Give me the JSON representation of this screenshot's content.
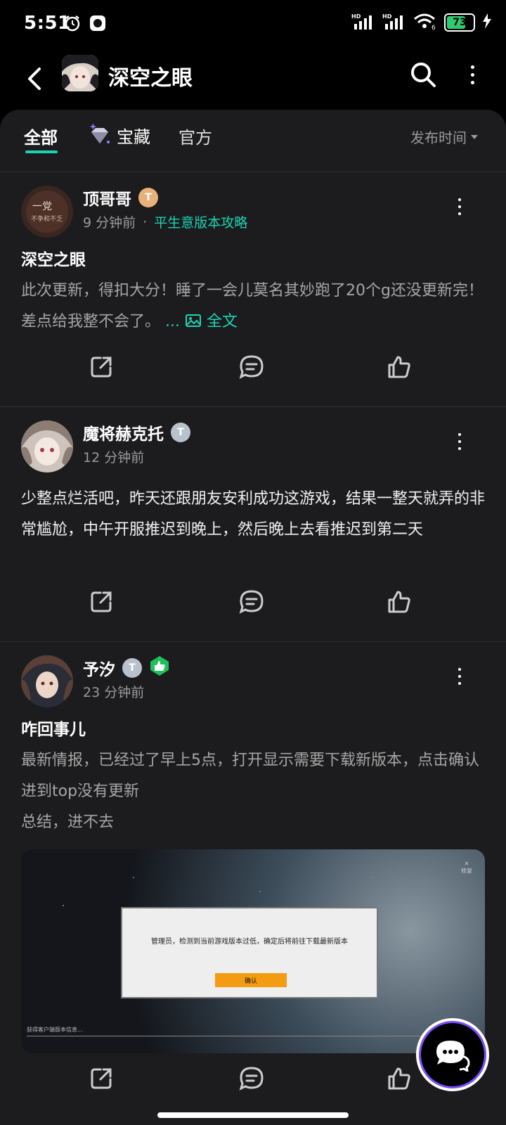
{
  "status_bar": {
    "time": "5:51",
    "battery": "73",
    "net_label_1": "HD",
    "net_label_2": "HD",
    "wifi_sub": "6"
  },
  "header": {
    "title": "深空之眼"
  },
  "tabs": {
    "all": "全部",
    "treasure": "宝藏",
    "official": "官方",
    "sort": "发布时间"
  },
  "posts": [
    {
      "author": "顶哥哥",
      "level": "T",
      "time": "9 分钟前",
      "topic": "平生意版本攻略",
      "title": "深空之眼",
      "body": "此次更新，得扣大分！睡了一会儿莫名其妙跑了20个g还没更新完！差点给我整不会了。",
      "ellipsis": "...",
      "full_text": "全文"
    },
    {
      "author": "魔将赫克托",
      "level": "T",
      "time": "12 分钟前",
      "body": "少整点烂活吧，昨天还跟朋友安利成功这游戏，结果一整天就弄的非常尴尬，中午开服推迟到晚上，然后晚上去看推迟到第二天"
    },
    {
      "author": "予汐",
      "level": "T",
      "time": "23 分钟前",
      "title": "咋回事儿",
      "body_line1": "最新情报，已经过了早上5点，打开显示需要下载新版本，点击确认进到top没有更新",
      "body_line2": "总结，进不去",
      "image": {
        "dialog_text": "管理员，检测到当前游戏版本过低，确定后将前往下载最新版本",
        "dialog_button": "确认",
        "footer_text": "获得客户端版本信息...",
        "corner_text": "修复"
      }
    }
  ],
  "colors": {
    "accent": "#1dd3b4",
    "panel": "#1c1c1e"
  }
}
